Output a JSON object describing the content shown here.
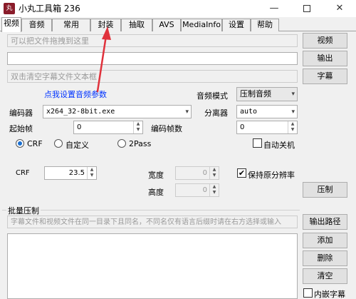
{
  "window": {
    "icon_text": "丸",
    "title": "小丸工具箱 236",
    "minimize": "—",
    "close": "✕"
  },
  "tabs": [
    {
      "label": "视频",
      "active": true
    },
    {
      "label": "音频"
    },
    {
      "label": "常用"
    },
    {
      "label": "封装"
    },
    {
      "label": "抽取"
    },
    {
      "label": "AVS"
    },
    {
      "label": "MediaInfo"
    },
    {
      "label": "设置"
    },
    {
      "label": "帮助"
    }
  ],
  "inputs": {
    "video_placeholder": "可以把文件拖拽到这里",
    "output_value": "",
    "subtitle_placeholder": "双击清空字幕文件文本框"
  },
  "buttons": {
    "video": "视频",
    "output": "输出",
    "subtitle": "字幕",
    "encode": "压制",
    "output_path": "输出路径",
    "add": "添加",
    "delete": "删除",
    "clear": "清空"
  },
  "audio": {
    "link": "点我设置音频参数",
    "mode_label": "音频模式",
    "mode_value": "压制音频"
  },
  "encoder": {
    "label": "编码器",
    "value": "x264_32-8bit.exe"
  },
  "splitter": {
    "label": "分离器",
    "value": "auto"
  },
  "start_frame": {
    "label": "起始帧",
    "value": "0"
  },
  "encode_frames": {
    "label": "编码帧数",
    "value": "0"
  },
  "rate_mode": {
    "options": [
      "CRF",
      "自定义",
      "2Pass"
    ],
    "selected": "CRF"
  },
  "auto_shutdown": {
    "label": "自动关机",
    "checked": false
  },
  "crf": {
    "label": "CRF",
    "value": "23.5"
  },
  "width": {
    "label": "宽度",
    "value": "0"
  },
  "height": {
    "label": "高度",
    "value": "0"
  },
  "keep_resolution": {
    "label": "保持原分辨率",
    "checked": true,
    "mark": "✔"
  },
  "batch": {
    "title": "批量压制",
    "hint": "字幕文件和视频文件在同一目录下且同名，不同名仅有语言后缀时请在右方选择或输入",
    "embed_subtitle": {
      "label": "内嵌字幕",
      "checked": false
    }
  },
  "annotation": {
    "color": "#e0323c"
  },
  "colors": {
    "link": "#0033ff",
    "accent": "#1a6fd1"
  }
}
